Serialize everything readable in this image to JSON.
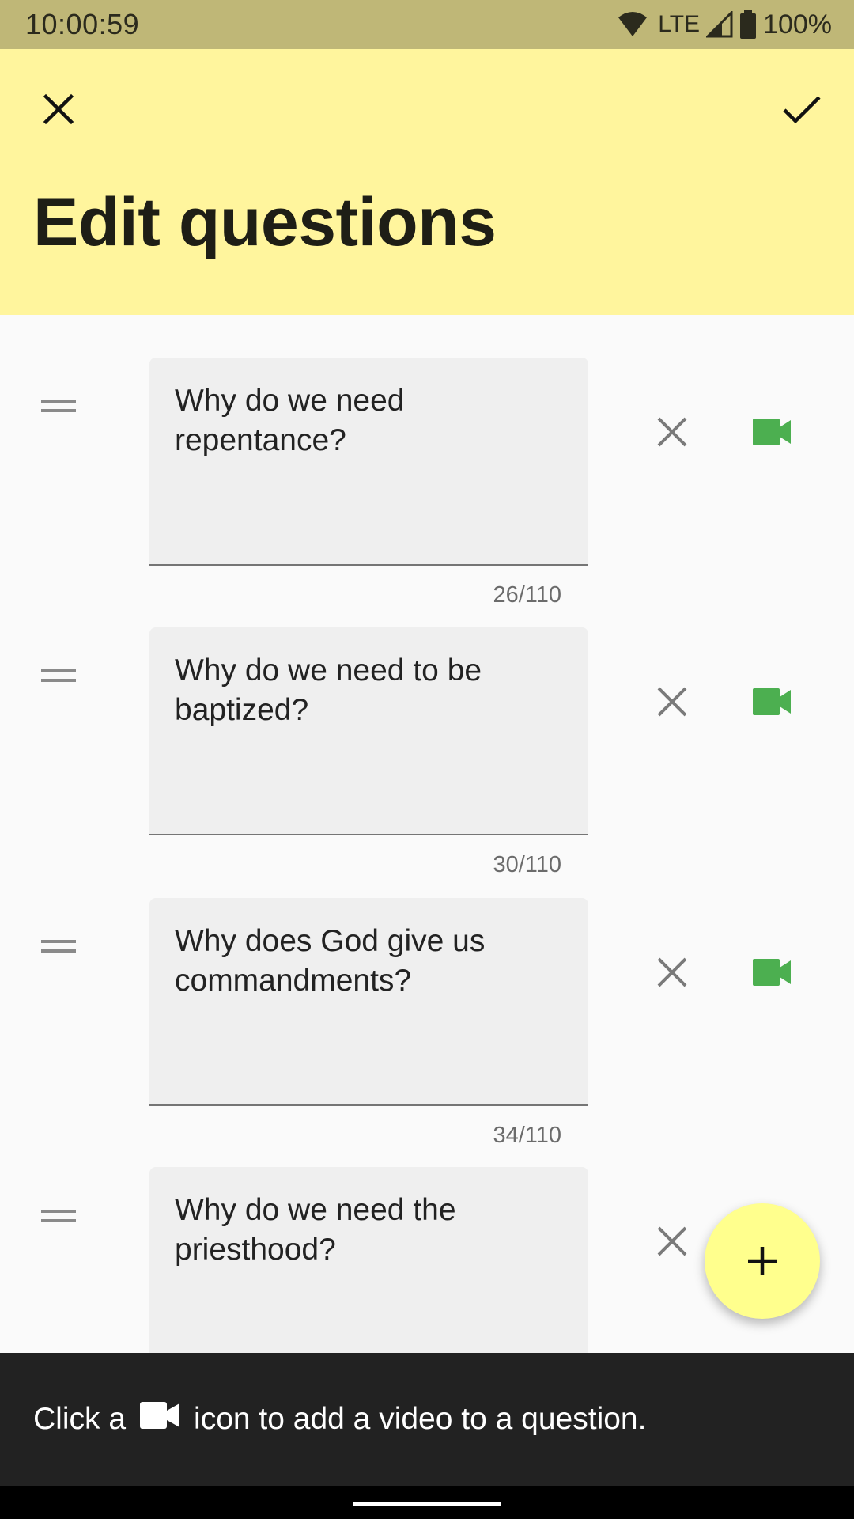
{
  "status_bar": {
    "time": "10:00:59",
    "network": "LTE",
    "battery": "100%"
  },
  "app_bar": {
    "title": "Edit questions",
    "close_icon": "close-icon",
    "confirm_icon": "check-icon"
  },
  "questions": [
    {
      "text": "Why do we need repentance?",
      "counter": "26/110",
      "has_video_button": true
    },
    {
      "text": "Why do we need to be baptized?",
      "counter": "30/110",
      "has_video_button": true
    },
    {
      "text": "Why does God give us commandments?",
      "counter": "34/110",
      "has_video_button": true
    },
    {
      "text": "Why do we need the priesthood?",
      "counter": "",
      "has_video_button": false
    }
  ],
  "fab": {
    "icon": "plus-icon"
  },
  "snackbar": {
    "text_before": "Click a",
    "text_after": "icon to add a video to a question."
  },
  "colors": {
    "status_bar": "#bfb777",
    "app_bar": "#fff59d",
    "fab": "#ffff8d",
    "video_icon": "#4caf50",
    "snackbar": "#222222"
  }
}
